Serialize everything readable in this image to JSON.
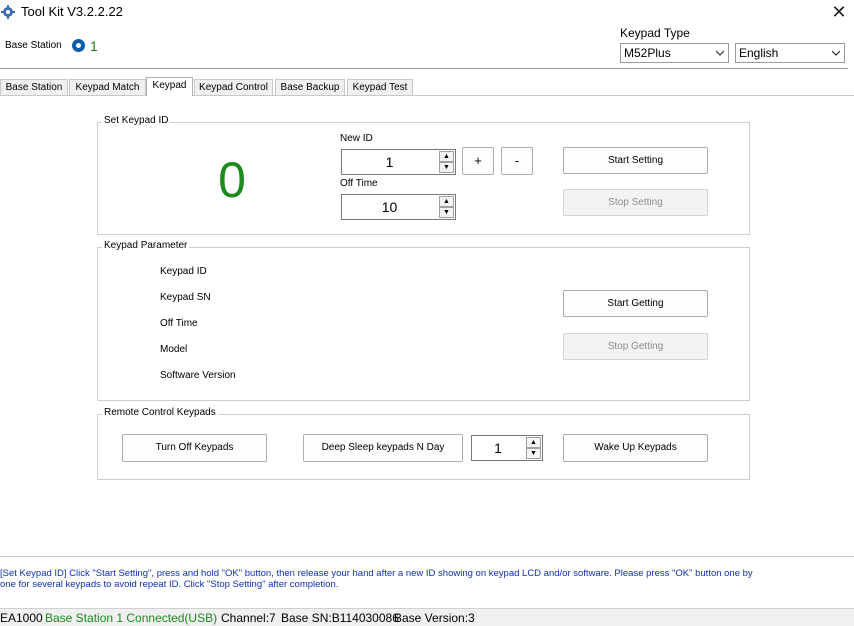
{
  "window": {
    "title": "Tool Kit  V3.2.2.22",
    "close_icon": "close-icon"
  },
  "header": {
    "base_station_label": "Base Station",
    "base_station_value": "1",
    "keypad_type_label": "Keypad Type",
    "keypad_type_value": "M52Plus",
    "language_value": "English"
  },
  "tabs": [
    {
      "label": "Base Station"
    },
    {
      "label": "Keypad Match"
    },
    {
      "label": "Keypad"
    },
    {
      "label": "Keypad Control"
    },
    {
      "label": "Base Backup"
    },
    {
      "label": "Keypad Test"
    }
  ],
  "set_keypad_id": {
    "title": "Set Keypad ID",
    "current_id": "0",
    "new_id_label": "New ID",
    "new_id_value": "1",
    "off_time_label": "Off Time",
    "off_time_value": "10",
    "plus_label": "+",
    "minus_label": "-",
    "start_label": "Start Setting",
    "stop_label": "Stop Setting"
  },
  "keypad_parameter": {
    "title": "Keypad Parameter",
    "fields": [
      "Keypad ID",
      "Keypad SN",
      "Off Time",
      "Model",
      "Software Version"
    ],
    "start_label": "Start Getting",
    "stop_label": "Stop Getting"
  },
  "remote_control": {
    "title": "Remote Control Keypads",
    "turn_off_label": "Turn Off Keypads",
    "deep_sleep_label": "Deep Sleep keypads N Day",
    "days_value": "1",
    "wake_up_label": "Wake Up Keypads"
  },
  "info": {
    "line1": "[Set Keypad ID] Click \"Start Setting\", press and hold \"OK\" button, then release your hand after a new ID showing on keypad LCD and/or software. Please press \"OK\" button one by",
    "line2": "one for several keypads to avoid repeat ID. Click \"Stop Setting\" after completion."
  },
  "status_bar": {
    "model": "EA1000",
    "connection": "Base Station 1 Connected(USB)",
    "channel": "Channel:7",
    "base_sn": "Base SN:B114030086",
    "base_version": "Base Version:3"
  },
  "colors": {
    "accent_green": "#1d8a1d",
    "info_blue": "#1030b0",
    "radio_blue": "#0a5ea8"
  }
}
